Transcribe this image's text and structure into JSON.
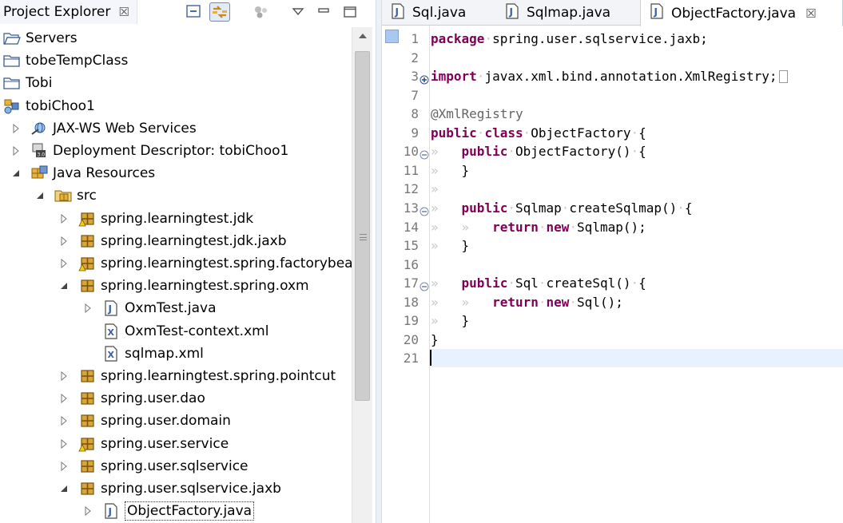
{
  "explorer": {
    "title": "Project Explorer",
    "close_glyph": "☒",
    "toolbar": [
      "collapse-all-icon",
      "link-with-editor-icon",
      "focus-icon",
      "view-menu-icon",
      "minimize-icon",
      "maximize-icon"
    ],
    "tree": [
      {
        "label": "Servers",
        "depth": 0,
        "twisty": "none",
        "icon": "folder-open-icon"
      },
      {
        "label": "tobeTempClass",
        "depth": 0,
        "twisty": "none",
        "icon": "folder-icon"
      },
      {
        "label": "Tobi",
        "depth": 0,
        "twisty": "none",
        "icon": "folder-icon"
      },
      {
        "label": "tobiChoo1",
        "depth": 0,
        "twisty": "none",
        "icon": "web-project-icon"
      },
      {
        "label": "JAX-WS Web Services",
        "depth": 1,
        "twisty": "collapsed",
        "icon": "web-services-icon"
      },
      {
        "label": "Deployment Descriptor: tobiChoo1",
        "depth": 1,
        "twisty": "collapsed",
        "icon": "deployment-descriptor-icon"
      },
      {
        "label": "Java Resources",
        "depth": 1,
        "twisty": "expanded",
        "icon": "java-resources-icon"
      },
      {
        "label": "src",
        "depth": 2,
        "twisty": "expanded",
        "icon": "source-folder-icon"
      },
      {
        "label": "spring.learningtest.jdk",
        "depth": 3,
        "twisty": "collapsed",
        "icon": "package-warning-icon"
      },
      {
        "label": "spring.learningtest.jdk.jaxb",
        "depth": 3,
        "twisty": "collapsed",
        "icon": "package-icon"
      },
      {
        "label": "spring.learningtest.spring.factorybean",
        "depth": 3,
        "twisty": "collapsed",
        "icon": "package-warning-icon"
      },
      {
        "label": "spring.learningtest.spring.oxm",
        "depth": 3,
        "twisty": "expanded",
        "icon": "package-icon"
      },
      {
        "label": "OxmTest.java",
        "depth": 4,
        "twisty": "collapsed",
        "icon": "java-file-icon"
      },
      {
        "label": "OxmTest-context.xml",
        "depth": 4,
        "twisty": "none",
        "icon": "xml-file-icon"
      },
      {
        "label": "sqlmap.xml",
        "depth": 4,
        "twisty": "none",
        "icon": "xml-file-icon"
      },
      {
        "label": "spring.learningtest.spring.pointcut",
        "depth": 3,
        "twisty": "collapsed",
        "icon": "package-icon"
      },
      {
        "label": "spring.user.dao",
        "depth": 3,
        "twisty": "collapsed",
        "icon": "package-icon"
      },
      {
        "label": "spring.user.domain",
        "depth": 3,
        "twisty": "collapsed",
        "icon": "package-icon"
      },
      {
        "label": "spring.user.service",
        "depth": 3,
        "twisty": "collapsed",
        "icon": "package-warning-icon"
      },
      {
        "label": "spring.user.sqlservice",
        "depth": 3,
        "twisty": "collapsed",
        "icon": "package-icon"
      },
      {
        "label": "spring.user.sqlservice.jaxb",
        "depth": 3,
        "twisty": "expanded",
        "icon": "package-icon"
      },
      {
        "label": "ObjectFactory.java",
        "depth": 4,
        "twisty": "collapsed",
        "icon": "java-file-icon",
        "selected": true
      }
    ]
  },
  "editor": {
    "tabs": [
      {
        "label": "Sql.java",
        "icon": "java-file-icon",
        "active": false
      },
      {
        "label": "Sqlmap.java",
        "icon": "java-file-icon",
        "active": false
      },
      {
        "label": "ObjectFactory.java",
        "icon": "java-file-icon",
        "active": true,
        "close_glyph": "☒"
      }
    ],
    "lines": [
      {
        "n": "1",
        "fold": "",
        "indent": "",
        "tokens": [
          [
            "kw",
            "package"
          ],
          [
            "ws",
            "·"
          ],
          [
            "t",
            "spring.user.sqlservice.jaxb;"
          ]
        ]
      },
      {
        "n": "2",
        "fold": "",
        "indent": "",
        "tokens": []
      },
      {
        "n": "3",
        "fold": "plus",
        "indent": "",
        "tokens": [
          [
            "kw",
            "import"
          ],
          [
            "ws",
            "·"
          ],
          [
            "t",
            "javax.xml.bind.annotation.XmlRegistry;"
          ],
          [
            "ellip",
            ""
          ]
        ]
      },
      {
        "n": "7",
        "fold": "",
        "indent": "",
        "tokens": []
      },
      {
        "n": "8",
        "fold": "",
        "indent": "",
        "tokens": [
          [
            "an",
            "@XmlRegistry"
          ]
        ]
      },
      {
        "n": "9",
        "fold": "",
        "indent": "",
        "tokens": [
          [
            "kw",
            "public"
          ],
          [
            "ws",
            "·"
          ],
          [
            "kw",
            "class"
          ],
          [
            "ws",
            "·"
          ],
          [
            "t",
            "ObjectFactory"
          ],
          [
            "ws",
            "·"
          ],
          [
            "t",
            "{"
          ]
        ]
      },
      {
        "n": "10",
        "fold": "minus",
        "indent": "1",
        "tokens": [
          [
            "kw",
            "public"
          ],
          [
            "ws",
            "·"
          ],
          [
            "t",
            "ObjectFactory()"
          ],
          [
            "ws",
            "·"
          ],
          [
            "t",
            "{"
          ]
        ]
      },
      {
        "n": "11",
        "fold": "",
        "indent": "1",
        "tokens": [
          [
            "t",
            "}"
          ]
        ]
      },
      {
        "n": "12",
        "fold": "",
        "indent": "1",
        "tokens": []
      },
      {
        "n": "13",
        "fold": "minus",
        "indent": "1",
        "tokens": [
          [
            "kw",
            "public"
          ],
          [
            "ws",
            "·"
          ],
          [
            "t",
            "Sqlmap"
          ],
          [
            "ws",
            "·"
          ],
          [
            "t",
            "createSqlmap()"
          ],
          [
            "ws",
            "·"
          ],
          [
            "t",
            "{"
          ]
        ]
      },
      {
        "n": "14",
        "fold": "",
        "indent": "2",
        "tokens": [
          [
            "kw",
            "return"
          ],
          [
            "ws",
            "·"
          ],
          [
            "kw",
            "new"
          ],
          [
            "ws",
            "·"
          ],
          [
            "t",
            "Sqlmap();"
          ]
        ]
      },
      {
        "n": "15",
        "fold": "",
        "indent": "1",
        "tokens": [
          [
            "t",
            "}"
          ]
        ]
      },
      {
        "n": "16",
        "fold": "",
        "indent": "",
        "tokens": []
      },
      {
        "n": "17",
        "fold": "minus",
        "indent": "1",
        "tokens": [
          [
            "kw",
            "public"
          ],
          [
            "ws",
            "·"
          ],
          [
            "t",
            "Sql"
          ],
          [
            "ws",
            "·"
          ],
          [
            "t",
            "createSql()"
          ],
          [
            "ws",
            "·"
          ],
          [
            "t",
            "{"
          ]
        ]
      },
      {
        "n": "18",
        "fold": "",
        "indent": "2",
        "tokens": [
          [
            "kw",
            "return"
          ],
          [
            "ws",
            "·"
          ],
          [
            "kw",
            "new"
          ],
          [
            "ws",
            "·"
          ],
          [
            "t",
            "Sql();"
          ]
        ]
      },
      {
        "n": "19",
        "fold": "",
        "indent": "1",
        "tokens": [
          [
            "t",
            "}"
          ]
        ]
      },
      {
        "n": "20",
        "fold": "",
        "indent": "",
        "tokens": [
          [
            "t",
            "}"
          ]
        ]
      },
      {
        "n": "21",
        "fold": "",
        "indent": "",
        "tokens": [
          [
            "caret",
            ""
          ]
        ],
        "current": true
      }
    ]
  },
  "colors": {
    "keyword": "#7f0055",
    "annotation": "#646464",
    "line_number": "#787878",
    "current_line": "#e8f2fe",
    "selection_mark": "#a9c8f0"
  }
}
